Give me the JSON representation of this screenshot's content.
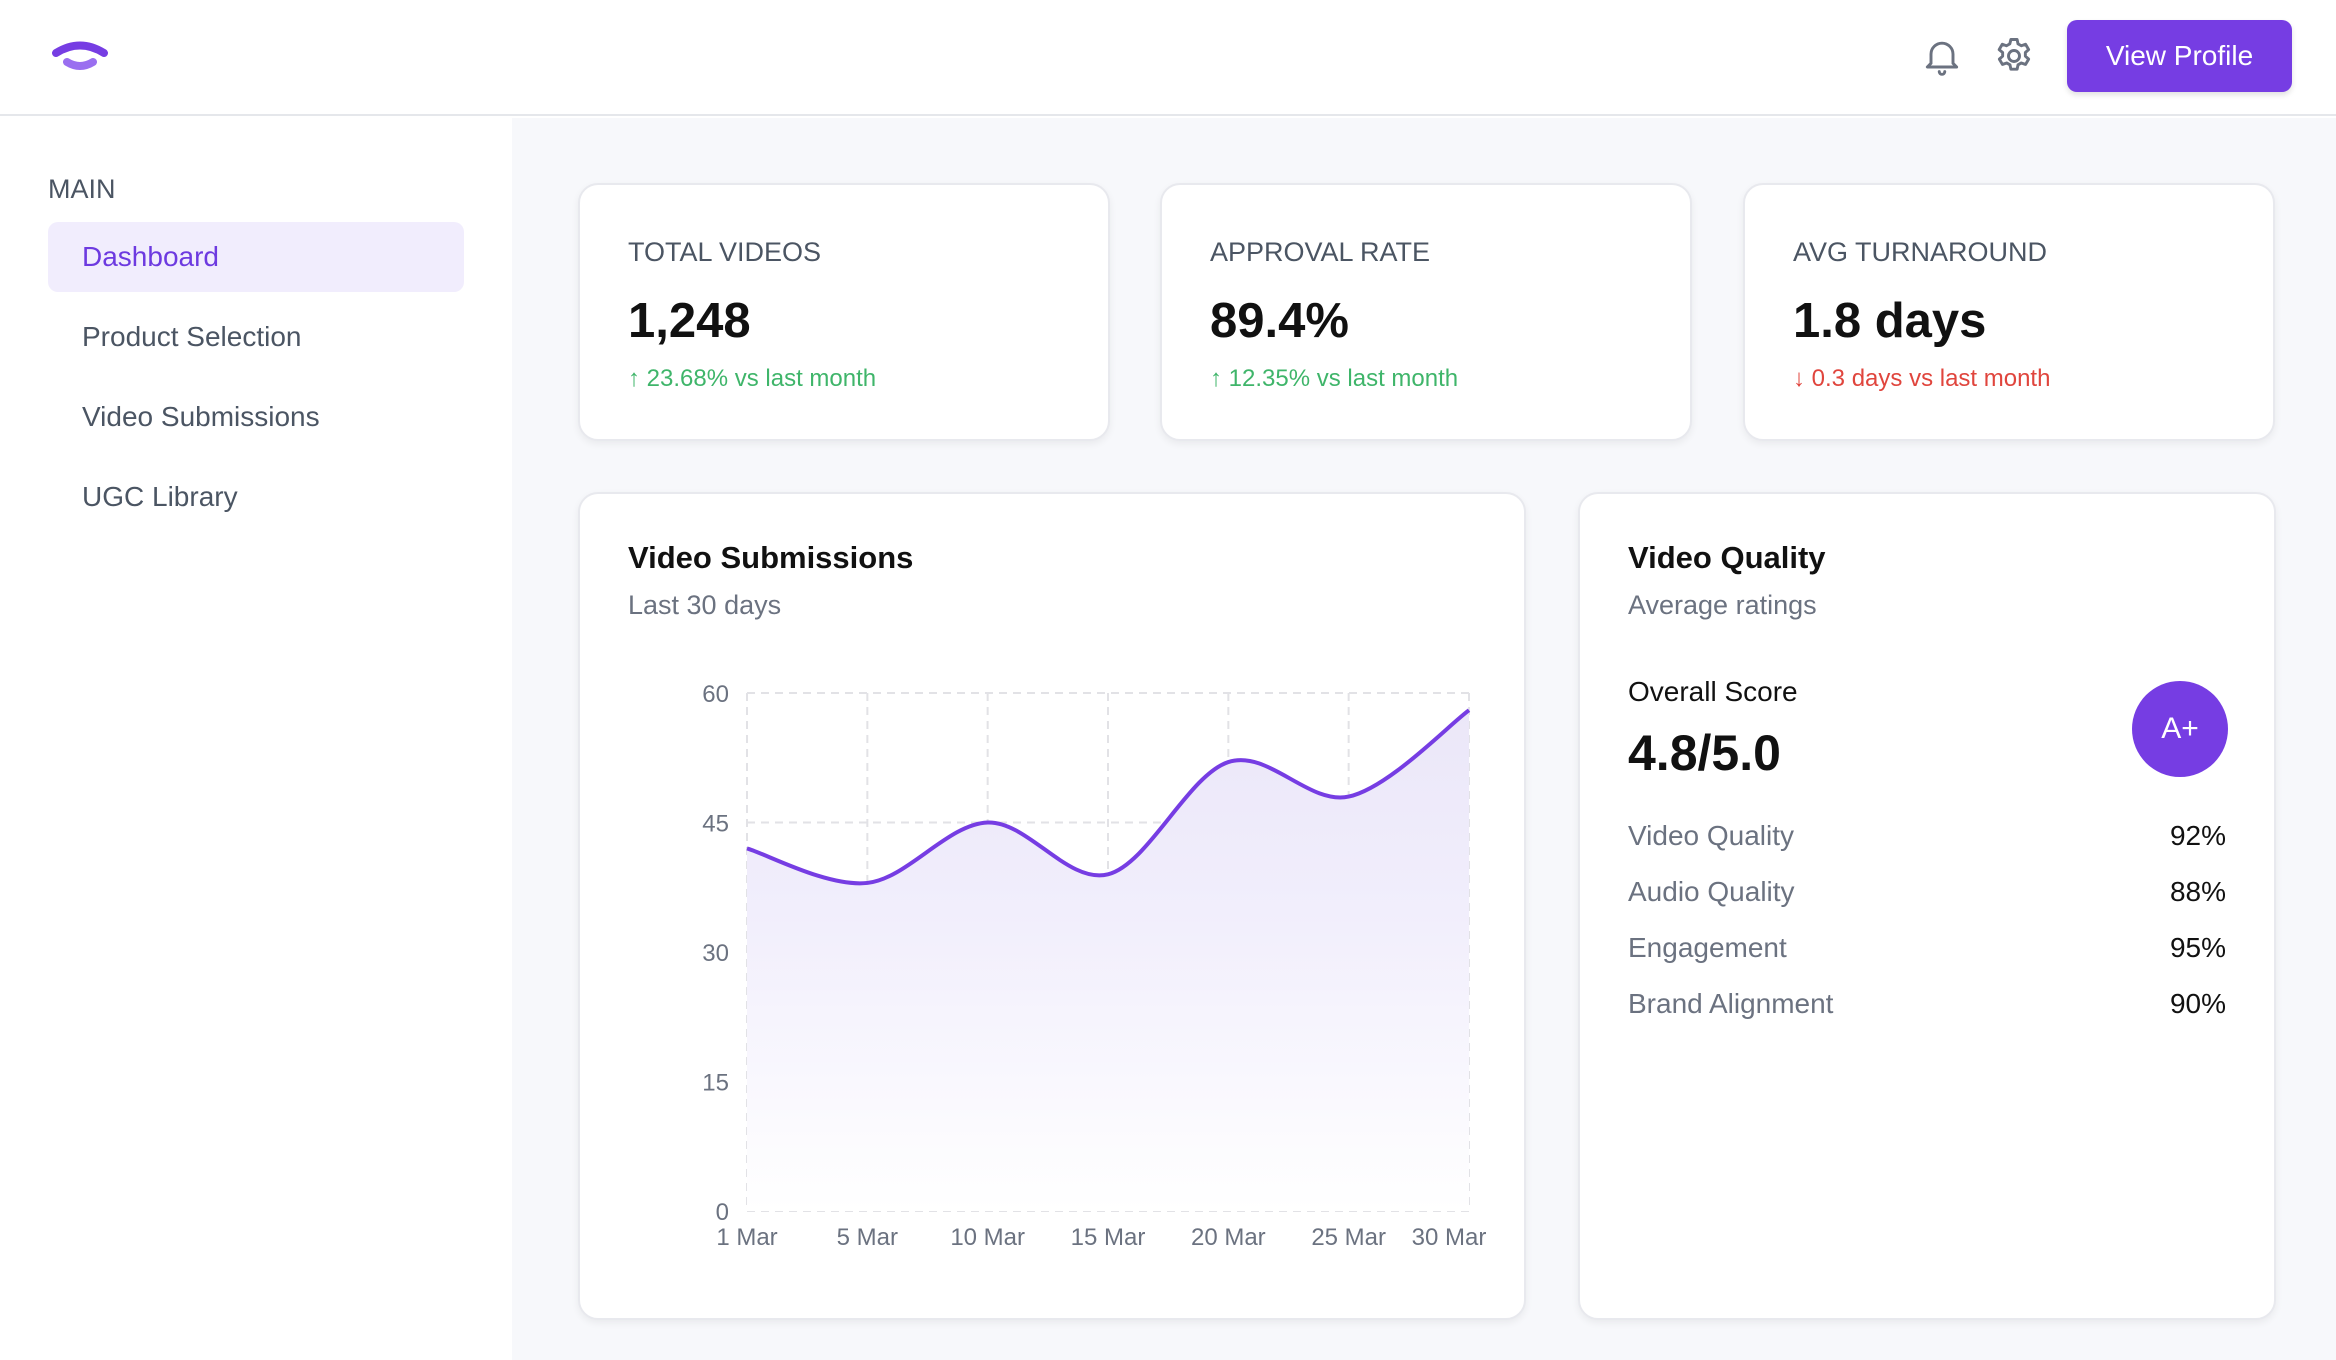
{
  "header": {
    "logo": "logo-icon",
    "icons": [
      "bell-icon",
      "gear-icon"
    ],
    "view_profile": "View Profile"
  },
  "sidebar": {
    "section": "MAIN",
    "items": [
      {
        "label": "Dashboard",
        "active": true
      },
      {
        "label": "Product Selection"
      },
      {
        "label": "Video Submissions"
      },
      {
        "label": "UGC Library"
      }
    ]
  },
  "stats": [
    {
      "label": "TOTAL VIDEOS",
      "value": "1,248",
      "change": "↑ 23.68% vs last month",
      "trend": "up"
    },
    {
      "label": "APPROVAL RATE",
      "value": "89.4%",
      "change": "↑ 12.35% vs last month",
      "trend": "up"
    },
    {
      "label": "AVG TURNAROUND",
      "value": "1.8 days",
      "change": "↓ 0.3 days vs last month",
      "trend": "down"
    }
  ],
  "submissions": {
    "title": "Video Submissions",
    "subtitle": "Last 30 days"
  },
  "chart_data": {
    "type": "area",
    "categories": [
      "1 Mar",
      "5 Mar",
      "10 Mar",
      "15 Mar",
      "20 Mar",
      "25 Mar",
      "30 Mar"
    ],
    "values": [
      42,
      38,
      45,
      39,
      52,
      48,
      58
    ],
    "ylim": [
      0,
      60
    ],
    "yticks": [
      "0",
      "15",
      "30",
      "45",
      "60"
    ],
    "grid": true,
    "color": "#763de3"
  },
  "quality": {
    "title": "Video Quality",
    "subtitle": "Average ratings",
    "overall_label": "Overall Score",
    "overall_value": "4.8/5.0",
    "grade": "A+",
    "metrics": [
      {
        "name": "Video Quality",
        "value": "92%"
      },
      {
        "name": "Audio Quality",
        "value": "88%"
      },
      {
        "name": "Engagement",
        "value": "95%"
      },
      {
        "name": "Brand Alignment",
        "value": "90%"
      }
    ]
  },
  "colors": {
    "accent": "#763de3",
    "up": "#3fb56a",
    "down": "#e0453d"
  }
}
